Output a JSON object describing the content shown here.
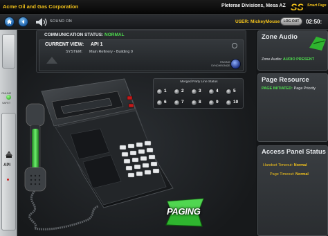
{
  "topbar": {
    "company": "Acme Oil and Gas Corporation",
    "location": "Pleterae Divisions, Mesa AZ",
    "brand_main": "SS",
    "brand_sub": "Smart Page"
  },
  "navbar": {
    "sound_label": "SOUND ON",
    "user_label": "USER:",
    "user_name": "MickeyMouse",
    "logout_label": "LOG OUT",
    "clock": "02:50:"
  },
  "sidebar": {
    "online_label": "ONLINE",
    "secondary_label": "SAFET",
    "api_label": "API"
  },
  "status": {
    "comm_label": "COMMUNICATION STATUS:",
    "comm_value": "NORMAL",
    "view_label": "CURRENT VIEW:",
    "view_value": "API 1",
    "system_label": "SYSTEM:",
    "system_value": "Main Refinery - Building 0",
    "sync_label_1": "PAGING",
    "sync_label_2": "SYNCHRONIZE"
  },
  "merged_party_line": {
    "title": "Merged Party Line Status",
    "lines": [
      "1",
      "2",
      "3",
      "4",
      "5",
      "6",
      "7",
      "8",
      "9",
      "10"
    ]
  },
  "paging_button": {
    "label": "PAGING"
  },
  "zone_audio": {
    "title": "Zone Audio",
    "label": "Zone Audio:",
    "value": "AUDIO PRESENT"
  },
  "page_resource": {
    "title": "Page Resource",
    "label": "PAGE INITIATED:",
    "value": "Page Priority"
  },
  "access_panel": {
    "title": "Access Panel Status",
    "handset_label": "Handset Timeout:",
    "handset_value": "Normal",
    "page_label": "Page Timeout:",
    "page_value": "Normal"
  },
  "colors": {
    "accent_yellow": "#f2c21b",
    "status_green": "#4fe04f",
    "paging_green": "#2fb52f",
    "nav_blue": "#1c5fa8"
  }
}
